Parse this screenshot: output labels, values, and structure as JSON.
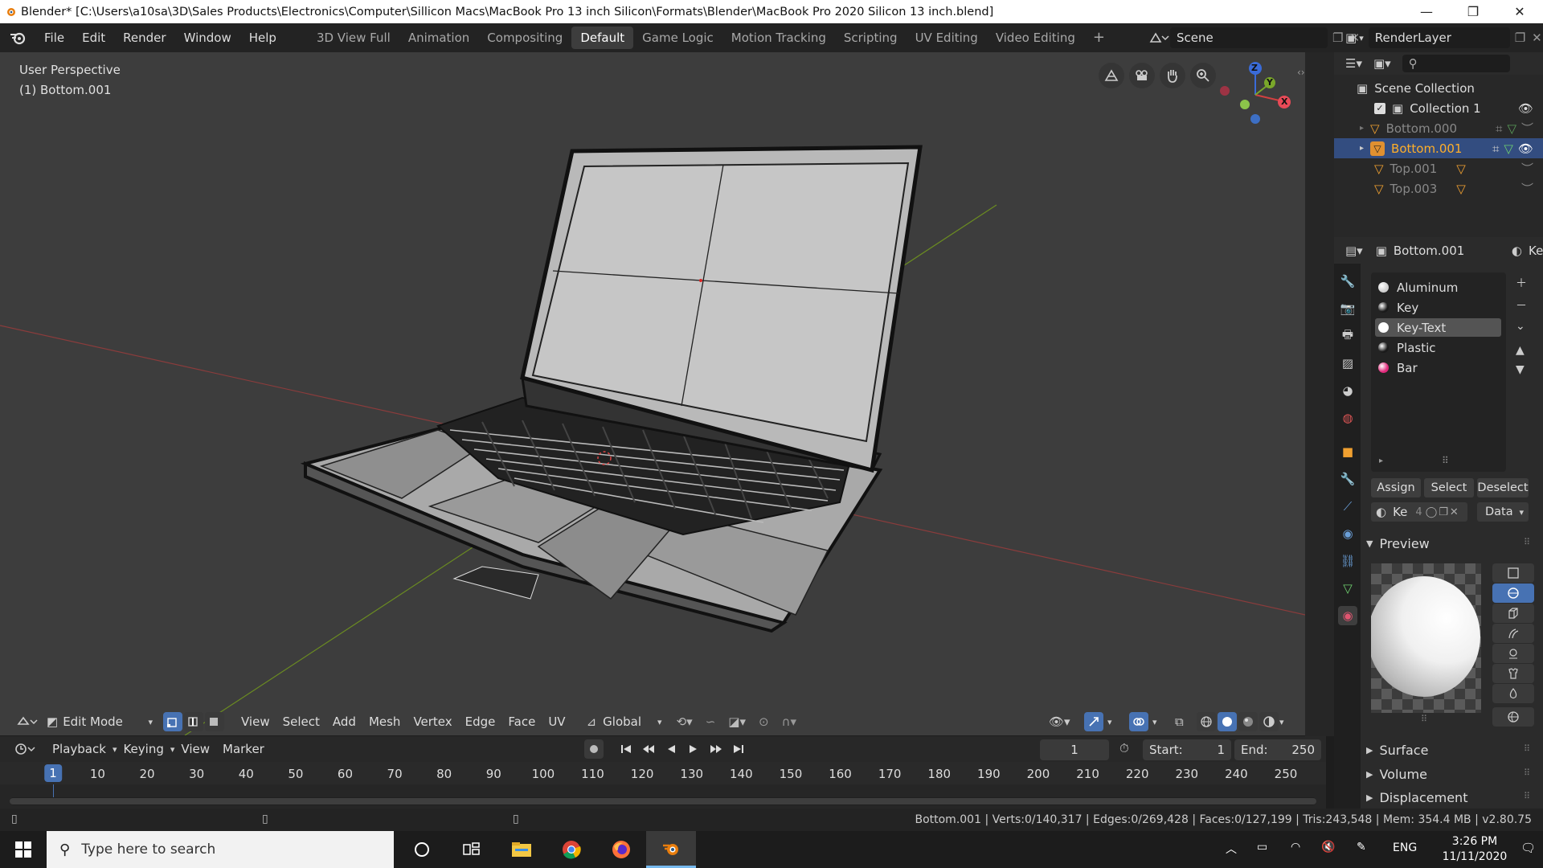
{
  "window": {
    "title": "Blender* [C:\\Users\\a10sa\\3D\\Sales Products\\Electronics\\Computer\\Sillicon Macs\\MacBook Pro 13 inch Silicon\\Formats\\Blender\\MacBook Pro 2020 Silicon 13 inch.blend]",
    "minimize": "—",
    "restore": "❐",
    "close": "✕"
  },
  "menus": [
    "File",
    "Edit",
    "Render",
    "Window",
    "Help"
  ],
  "workspaces": [
    {
      "label": "3D View Full",
      "active": false
    },
    {
      "label": "Animation",
      "active": false
    },
    {
      "label": "Compositing",
      "active": false
    },
    {
      "label": "Default",
      "active": true
    },
    {
      "label": "Game Logic",
      "active": false
    },
    {
      "label": "Motion Tracking",
      "active": false
    },
    {
      "label": "Scripting",
      "active": false
    },
    {
      "label": "UV Editing",
      "active": false
    },
    {
      "label": "Video Editing",
      "active": false
    }
  ],
  "add_workspace": "+",
  "scene": {
    "label": "Scene"
  },
  "render_layer": {
    "label": "RenderLayer"
  },
  "viewport": {
    "perspective": "User Perspective",
    "object": "(1) Bottom.001",
    "gizmo": {
      "z": "Z",
      "y": "Y",
      "x": "X"
    }
  },
  "outliner": {
    "root": "Scene Collection",
    "collection": "Collection 1",
    "items": [
      {
        "label": "Bottom.000",
        "selected": false
      },
      {
        "label": "Bottom.001",
        "selected": true
      },
      {
        "label": "Top.001",
        "selected": false
      },
      {
        "label": "Top.003",
        "selected": false
      }
    ]
  },
  "properties": {
    "object_name": "Bottom.001",
    "tab_label": "Key",
    "materials": [
      {
        "label": "Aluminum",
        "color": "#cfcfcf",
        "active": false
      },
      {
        "label": "Key",
        "color": "#1a1a1a",
        "active": false
      },
      {
        "label": "Key-Text",
        "color": "#ffffff",
        "active": true
      },
      {
        "label": "Plastic",
        "color": "#1a1a1a",
        "active": false
      },
      {
        "label": "Bar",
        "color": "#e0287a",
        "active": false
      }
    ],
    "assign": "Assign",
    "select": "Select",
    "deselect": "Deselect",
    "material_name": "Ke",
    "users": "4",
    "link": "Data",
    "sections": {
      "preview": "Preview",
      "surface": "Surface",
      "volume": "Volume",
      "displacement": "Displacement"
    }
  },
  "header3d": {
    "mode": "Edit Mode",
    "view": "View",
    "select": "Select",
    "add": "Add",
    "mesh": "Mesh",
    "vertex": "Vertex",
    "edge": "Edge",
    "face": "Face",
    "uv": "UV",
    "orientation": "Global"
  },
  "timeline": {
    "playback": "Playback",
    "keying": "Keying",
    "view": "View",
    "marker": "Marker",
    "current_frame": "1",
    "start_label": "Start:",
    "start": "1",
    "end_label": "End:",
    "end": "250",
    "ticks": [
      "1",
      "10",
      "20",
      "30",
      "40",
      "50",
      "60",
      "70",
      "80",
      "90",
      "100",
      "110",
      "120",
      "130",
      "140",
      "150",
      "160",
      "170",
      "180",
      "190",
      "200",
      "210",
      "220",
      "230",
      "240",
      "250"
    ]
  },
  "status": {
    "text": "Bottom.001 | Verts:0/140,317 | Edges:0/269,428 | Faces:0/127,199 | Tris:243,548 | Mem: 354.4 MB | v2.80.75"
  },
  "taskbar": {
    "search_placeholder": "Type here to search",
    "lang": "ENG",
    "time": "3:26 PM",
    "date": "11/11/2020"
  },
  "colors": {
    "accent_blue": "#4772b3",
    "selected_orange": "#ffaf29",
    "viewport_bg": "#3d3d3d",
    "x_axis": "#9b3a3a",
    "y_axis": "#6b8c21"
  }
}
